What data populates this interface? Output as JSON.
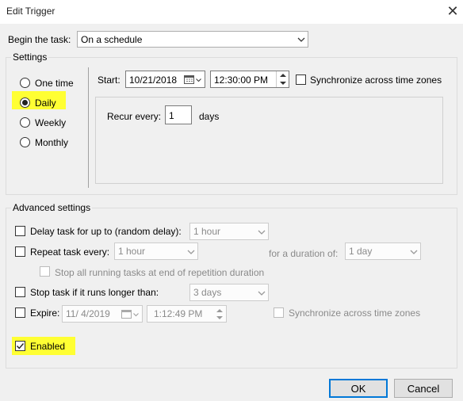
{
  "window": {
    "title": "Edit Trigger",
    "close_icon": "close-icon"
  },
  "begin": {
    "label": "Begin the task:",
    "value": "On a schedule"
  },
  "settings": {
    "legend": "Settings",
    "radios": [
      "One time",
      "Daily",
      "Weekly",
      "Monthly"
    ],
    "selected": "Daily",
    "start_label": "Start:",
    "start_date": "10/21/2018",
    "start_time": "12:30:00 PM",
    "sync_label": "Synchronize across time zones",
    "recur_label": "Recur every:",
    "recur_value": "1",
    "recur_unit": "days"
  },
  "advanced": {
    "legend": "Advanced settings",
    "delay_label": "Delay task for up to (random delay):",
    "delay_value": "1 hour",
    "repeat_label": "Repeat task every:",
    "repeat_value": "1 hour",
    "duration_label": "for a duration of:",
    "duration_value": "1 day",
    "stop_all_label": "Stop all running tasks at end of repetition duration",
    "stop_if_label": "Stop task if it runs longer than:",
    "stop_if_value": "3 days",
    "expire_label": "Expire:",
    "expire_date": "11/ 4/2019",
    "expire_time": "1:12:49 PM",
    "expire_sync_label": "Synchronize across time zones",
    "enabled_label": "Enabled",
    "enabled_checked": true
  },
  "buttons": {
    "ok": "OK",
    "cancel": "Cancel"
  },
  "colors": {
    "highlight": "#ffff33",
    "accent": "#0078d7"
  }
}
